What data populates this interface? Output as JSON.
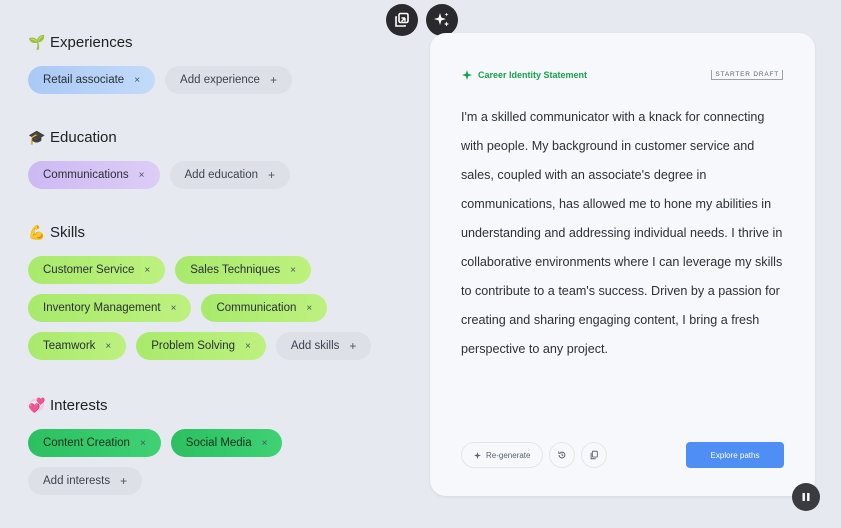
{
  "top_actions": {
    "copy_icon": "copy-icon",
    "sparkle_icon": "sparkle-icon"
  },
  "sections": {
    "experiences": {
      "emoji": "🌱",
      "title": "Experiences",
      "chips": [
        {
          "label": "Retail associate"
        }
      ],
      "add_label": "Add experience"
    },
    "education": {
      "emoji": "🎓",
      "title": "Education",
      "chips": [
        {
          "label": "Communications"
        }
      ],
      "add_label": "Add education"
    },
    "skills": {
      "emoji": "💪",
      "title": "Skills",
      "chips": [
        {
          "label": "Customer Service"
        },
        {
          "label": "Sales Techniques"
        },
        {
          "label": "Inventory Management"
        },
        {
          "label": "Communication"
        },
        {
          "label": "Teamwork"
        },
        {
          "label": "Problem Solving"
        }
      ],
      "add_label": "Add skills"
    },
    "interests": {
      "emoji": "💞",
      "title": "Interests",
      "chips": [
        {
          "label": "Content Creation"
        },
        {
          "label": "Social Media"
        }
      ],
      "add_label": "Add interests"
    }
  },
  "chip_remove_glyph": "×",
  "chip_add_glyph": "+",
  "card": {
    "label": "Career Identity Statement",
    "draft_tag": "STARTER DRAFT",
    "statement": "I'm a skilled communicator with a knack for connecting with people. My background in customer service and sales, coupled with an associate's degree in communications, has allowed me to hone my abilities in understanding and addressing individual needs. I thrive in collaborative environments where I can leverage my skills to contribute to a team's success. Driven by a passion for creating and sharing engaging content, I bring a fresh perspective to any project.",
    "regenerate_label": "Re-generate",
    "explore_label": "Explore paths"
  },
  "colors": {
    "experience_chip": "#b7d3f7",
    "education_chip": "#d6c6f4",
    "skill_chip": "#b2ee78",
    "interest_chip": "#34c76a",
    "accent_green": "#17a34a",
    "primary_button": "#4f8ff5"
  }
}
